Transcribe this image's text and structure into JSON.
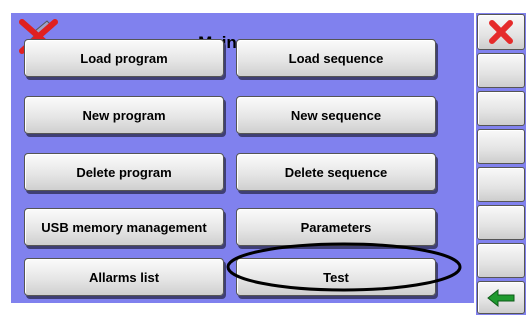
{
  "header": {
    "title": "Main menu",
    "logo_icon": "crossed-out-tool-icon"
  },
  "menu": {
    "load_program": "Load program",
    "load_sequence": "Load sequence",
    "new_program": "New program",
    "new_sequence": "New sequence",
    "delete_program": "Delete program",
    "delete_sequence": "Delete sequence",
    "usb_memory_management": "USB memory management",
    "parameters": "Parameters",
    "allarms_list": "Allarms list",
    "test": "Test"
  },
  "side_panel": {
    "close_icon": "red-x-icon",
    "back_icon": "green-left-arrow-icon",
    "empty_slots": 6
  },
  "colors": {
    "background": "#8081ee",
    "button_face": "#e6e6e6",
    "close_red": "#e52b2b",
    "back_green": "#1f9a2f",
    "highlight_outline": "#000000"
  }
}
